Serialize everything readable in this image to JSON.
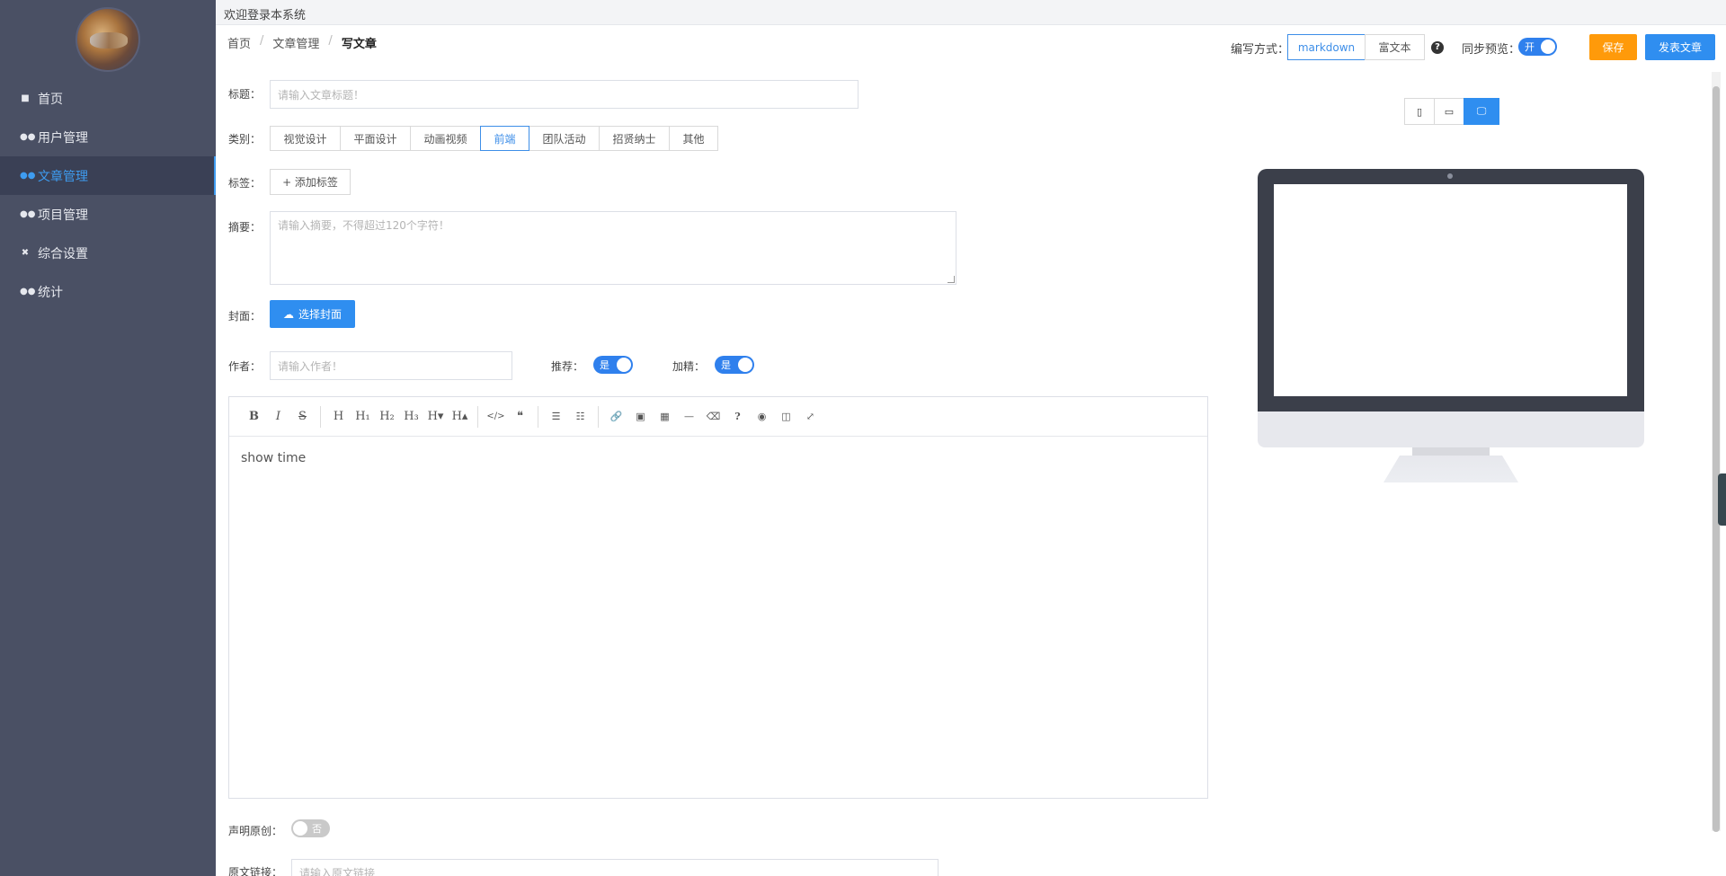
{
  "topbar": {
    "welcome": "欢迎登录本系统"
  },
  "sidebar": {
    "items": [
      {
        "label": "首页",
        "icon": "home-icon",
        "active": false
      },
      {
        "label": "用户管理",
        "icon": "users-icon",
        "active": false
      },
      {
        "label": "文章管理",
        "icon": "article-icon",
        "active": true
      },
      {
        "label": "项目管理",
        "icon": "project-icon",
        "active": false
      },
      {
        "label": "综合设置",
        "icon": "settings-icon",
        "active": false
      },
      {
        "label": "统计",
        "icon": "stats-icon",
        "active": false
      }
    ]
  },
  "breadcrumb": {
    "home": "首页",
    "section": "文章管理",
    "current": "写文章"
  },
  "header": {
    "write_mode_label": "编写方式：",
    "mode_markdown": "markdown",
    "mode_richtext": "富文本",
    "help": "?",
    "sync_label": "同步预览：",
    "sync_on": "开",
    "save": "保存",
    "publish": "发表文章"
  },
  "form": {
    "title_label": "标题：",
    "title_placeholder": "请输入文章标题！",
    "category_label": "类别：",
    "categories": [
      "视觉设计",
      "平面设计",
      "动画视频",
      "前端",
      "团队活动",
      "招贤纳士",
      "其他"
    ],
    "selected_category": "前端",
    "tags_label": "标签：",
    "add_tag": "+ 添加标签",
    "summary_label": "摘要：",
    "summary_placeholder": "请输入摘要，不得超过120个字符！",
    "cover_label": "封面：",
    "cover_button": "选择封面",
    "author_label": "作者：",
    "author_placeholder": "请输入作者！",
    "recommend_label": "推荐：",
    "recommend_value": "是",
    "featured_label": "加精：",
    "featured_value": "是",
    "original_label": "声明原创：",
    "original_value": "否",
    "source_label": "原文链接：",
    "source_placeholder": "请输入原文链接"
  },
  "editor": {
    "content": "show time",
    "toolbar": {
      "bold": "B",
      "italic": "I",
      "strike": "S",
      "h": "H",
      "h1": "H₁",
      "h2": "H₂",
      "h3": "H₃",
      "h_down": "H▾",
      "h_up": "H▴",
      "code": "</>",
      "quote": "❝",
      "ul": "☰",
      "ol": "☷",
      "link": "🔗",
      "image": "▣",
      "table": "▦",
      "hr": "—",
      "clear": "⌫",
      "help": "?",
      "preview": "◉",
      "split": "◫",
      "fullscreen": "⤢"
    }
  },
  "preview": {
    "devices": [
      "▯",
      "▭",
      "🖵"
    ],
    "selected_device": 2,
    "apple": ""
  }
}
